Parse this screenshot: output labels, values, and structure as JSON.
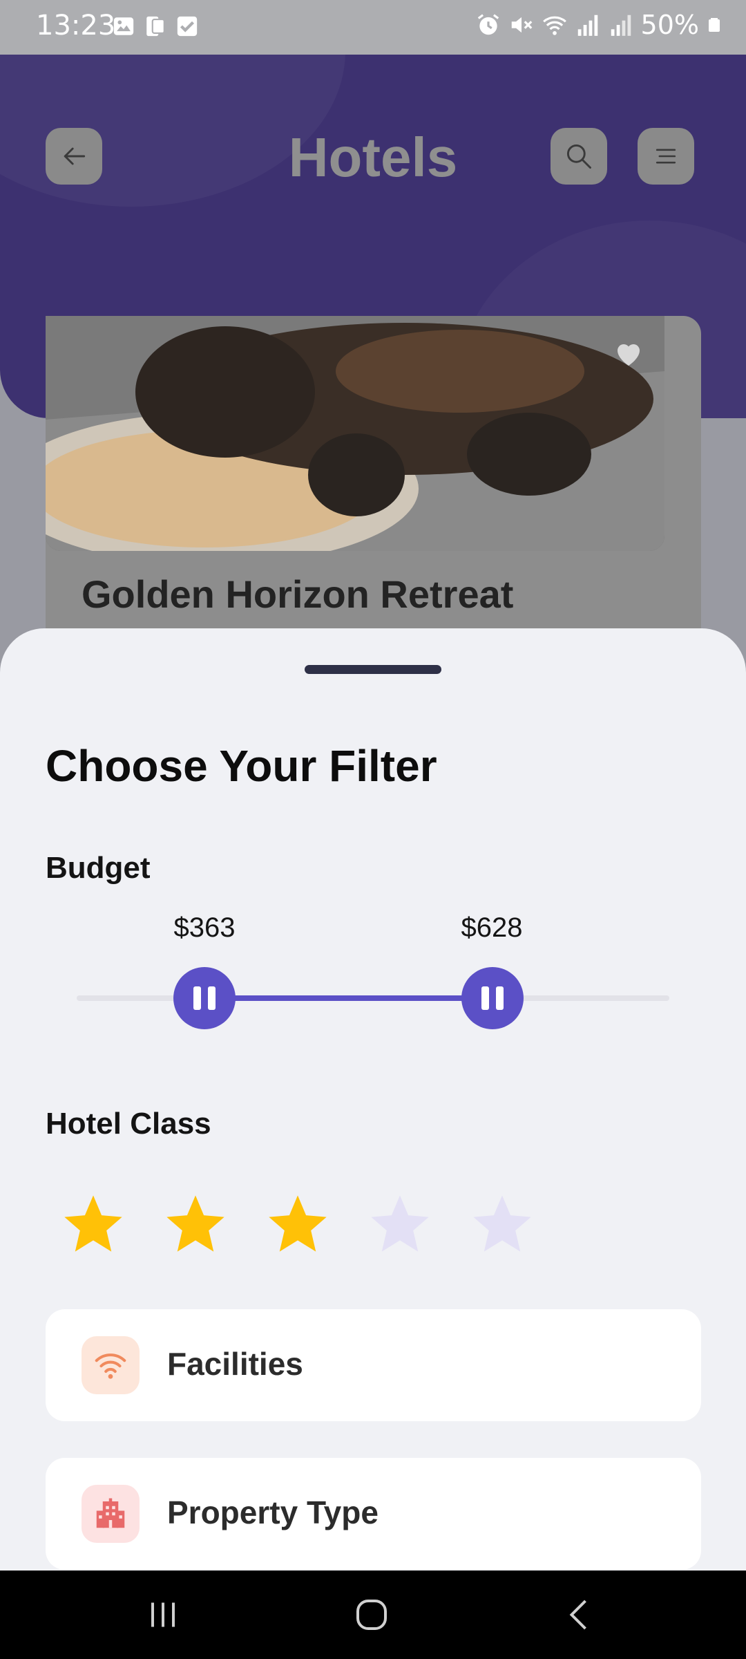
{
  "status_bar": {
    "time": "13:23",
    "battery": "50%",
    "left_icons": [
      "gallery-icon",
      "screen-icon",
      "check-icon"
    ],
    "right_icons": [
      "alarm-icon",
      "mute-icon",
      "wifi-icon",
      "signal-icon",
      "signal-icon",
      "battery-icon"
    ]
  },
  "header": {
    "title": "Hotels",
    "back_icon": "arrow-left-icon",
    "search_icon": "search-icon",
    "menu_icon": "menu-icon"
  },
  "hotel_card": {
    "name": "Golden Horizon Retreat",
    "image": "photo of a tortoiseshell cat eating from a plate",
    "favorite_icon": "heart-icon"
  },
  "filter_sheet": {
    "title": "Choose Your Filter",
    "budget": {
      "label": "Budget",
      "min_label": "$363",
      "max_label": "$628",
      "min_fraction": 0.216,
      "max_fraction": 0.702
    },
    "hotel_class": {
      "label": "Hotel Class",
      "rating": 3,
      "max": 5
    },
    "options": [
      {
        "label": "Facilities",
        "icon": "wifi-icon",
        "color": "#f08a5d"
      },
      {
        "label": "Property Type",
        "icon": "building-icon",
        "color": "#e86a6a"
      }
    ]
  },
  "colors": {
    "accent": "#5b50c6",
    "star_filled": "#ffc107",
    "star_empty": "#e3e0f5",
    "hero": "#3d3170"
  },
  "nav_bar": {
    "buttons": [
      "recent-apps-icon",
      "home-icon",
      "back-icon"
    ]
  }
}
